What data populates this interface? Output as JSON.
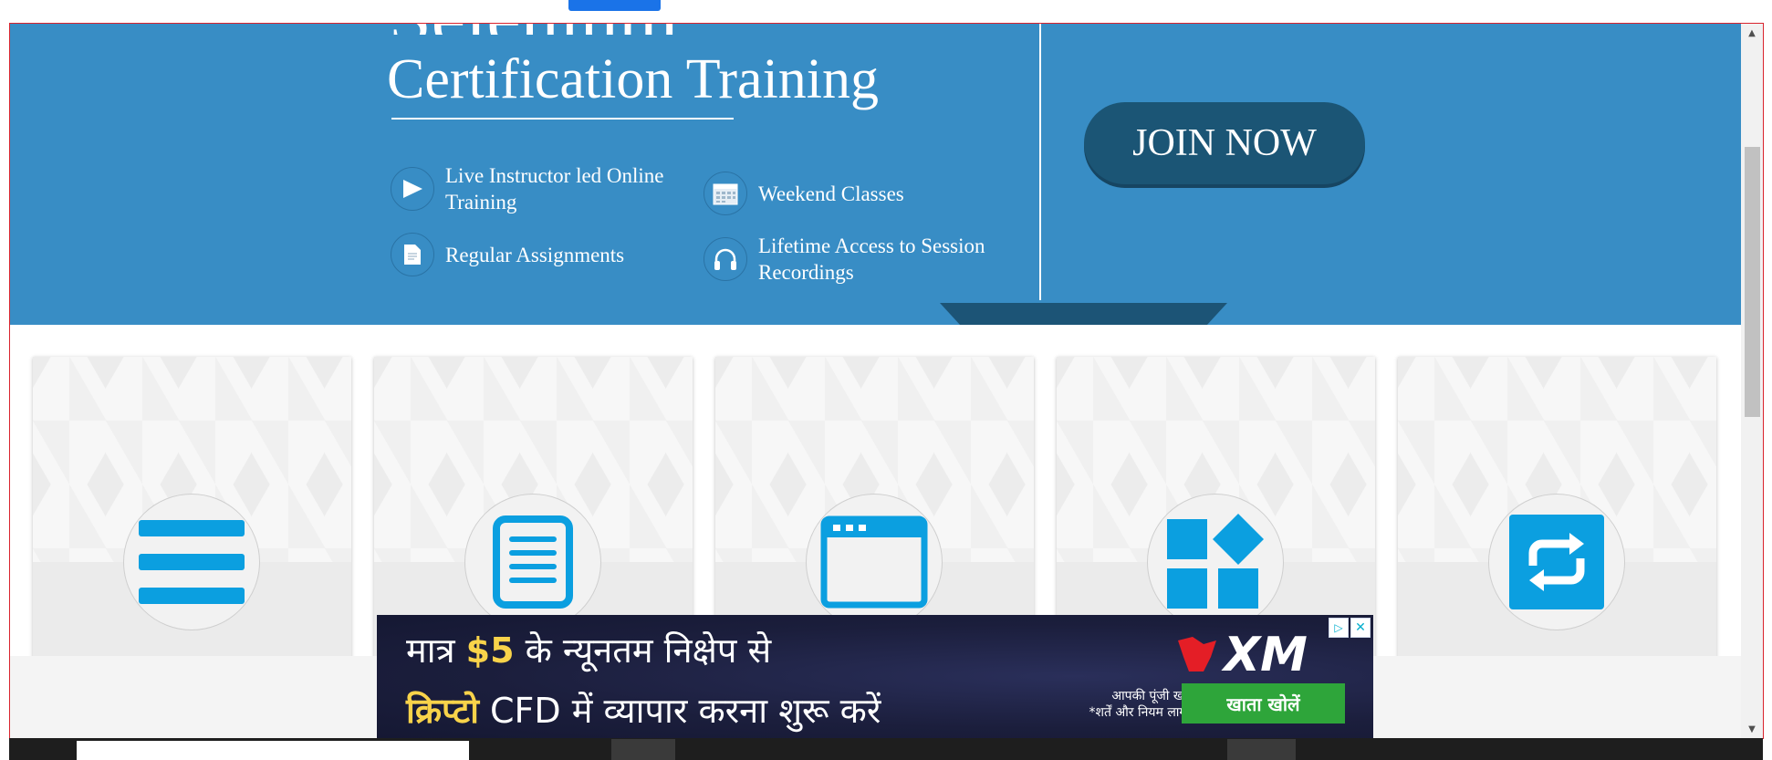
{
  "hero": {
    "title_top": "Selenium",
    "title": "Certification Training",
    "features": [
      {
        "label": "Live Instructor led Online Training",
        "icon": "play-icon"
      },
      {
        "label": "Weekend Classes",
        "icon": "calendar-icon"
      },
      {
        "label": "Regular Assignments",
        "icon": "document-icon"
      },
      {
        "label": "Lifetime Access to Session Recordings",
        "icon": "headphones-icon"
      }
    ],
    "join_button": "JOIN NOW"
  },
  "cards": [
    {
      "icon": "menu-lines-icon"
    },
    {
      "icon": "document-lines-icon"
    },
    {
      "icon": "browser-window-icon"
    },
    {
      "icon": "blocks-icon"
    },
    {
      "icon": "repeat-arrows-icon"
    }
  ],
  "ad": {
    "line1_prefix": "मात्र ",
    "line1_highlight": "$5",
    "line1_suffix": " के न्यूनतम निक्षेप से",
    "line2_highlight": "क्रिप्टो",
    "line2_suffix": " CFD में  व्यापार करना शुरू करें",
    "disclaimer_1": "आपकी पूंजी खतरे में है।",
    "disclaimer_2": "*शर्तें और नियम लागू होते हैं।",
    "button": "खाता खोलें",
    "logo_text": "XM"
  },
  "colors": {
    "hero_bg": "#388dc5",
    "join_bg": "#1b5575",
    "card_icon": "#0b9fe0",
    "ad_button": "#2ea53a"
  }
}
